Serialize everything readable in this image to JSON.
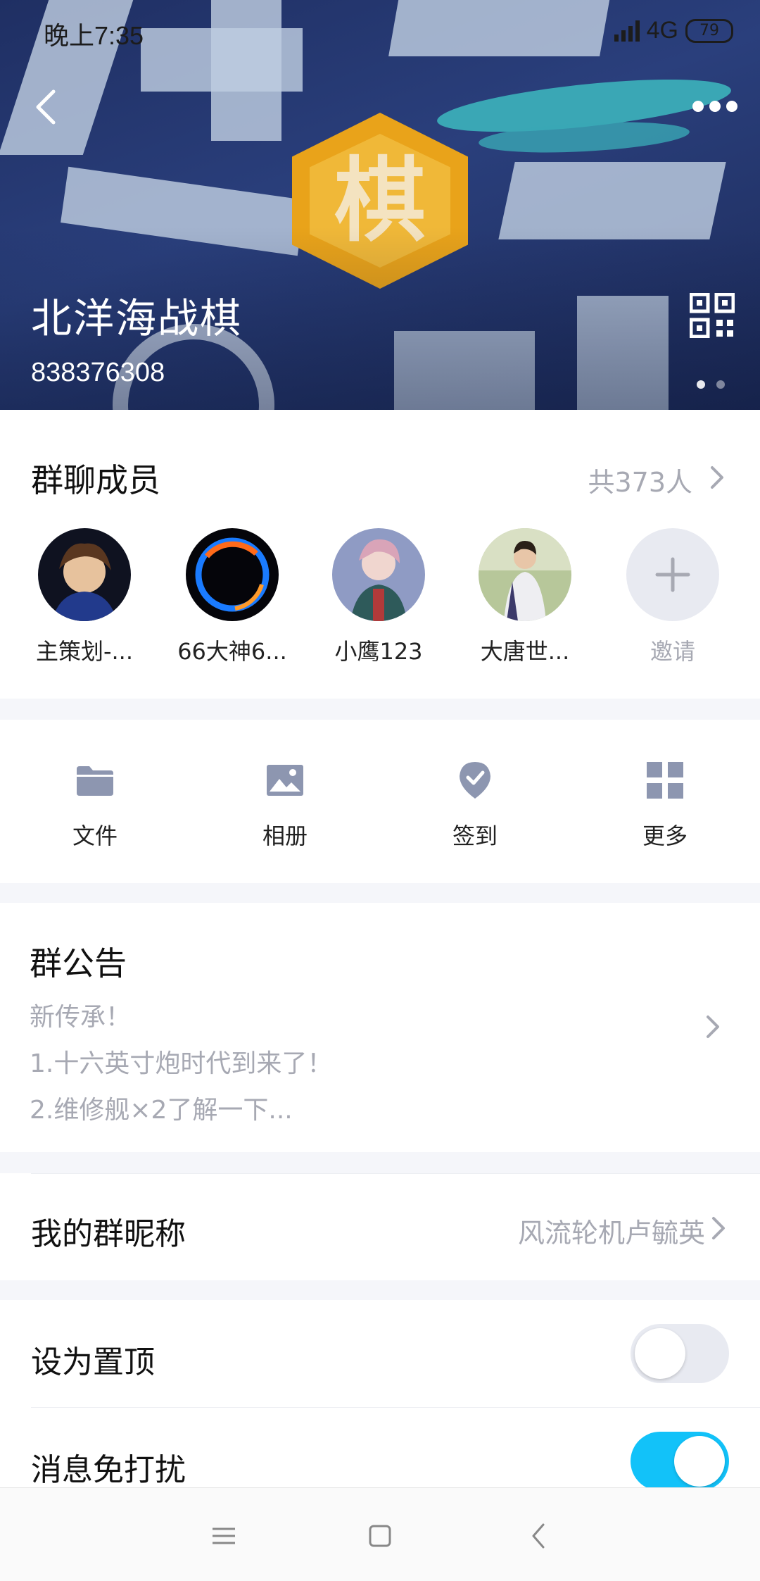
{
  "status_bar": {
    "time": "晚上7:35",
    "network": "4G",
    "battery": "79"
  },
  "header": {
    "group_name": "北洋海战棋",
    "group_id": "838376308",
    "banner_char": "棋",
    "banner_pages": 2,
    "banner_active_page": 1
  },
  "members": {
    "title": "群聊成员",
    "count_label": "共373人",
    "list": [
      {
        "name": "主策划-...",
        "avatar_color": "#2a3550"
      },
      {
        "name": "66大神6...",
        "avatar_color": "#0a0a14"
      },
      {
        "name": "小鹰123",
        "avatar_color": "#6b78a6"
      },
      {
        "name": "大唐世...",
        "avatar_color": "#a9b88a"
      }
    ],
    "invite_label": "邀请"
  },
  "tools": [
    {
      "label": "文件",
      "icon": "folder-icon"
    },
    {
      "label": "相册",
      "icon": "image-icon"
    },
    {
      "label": "签到",
      "icon": "checkin-badge-icon"
    },
    {
      "label": "更多",
      "icon": "grid-icon"
    }
  ],
  "notice": {
    "title": "群公告",
    "lines": [
      "新传承！",
      "1.十六英寸炮时代到来了！",
      "2.维修舰×2了解一下..."
    ]
  },
  "nickname": {
    "label": "我的群昵称",
    "value": "风流轮机卢毓英"
  },
  "settings": {
    "pin_label": "设为置顶",
    "pin_on": false,
    "mute_label": "消息免打扰",
    "mute_on": true
  },
  "colors": {
    "accent": "#12c2f9",
    "toggle_off": "#e8eaf1",
    "icon_gray": "#8d96b0",
    "muted_text": "#a7a9b3"
  }
}
